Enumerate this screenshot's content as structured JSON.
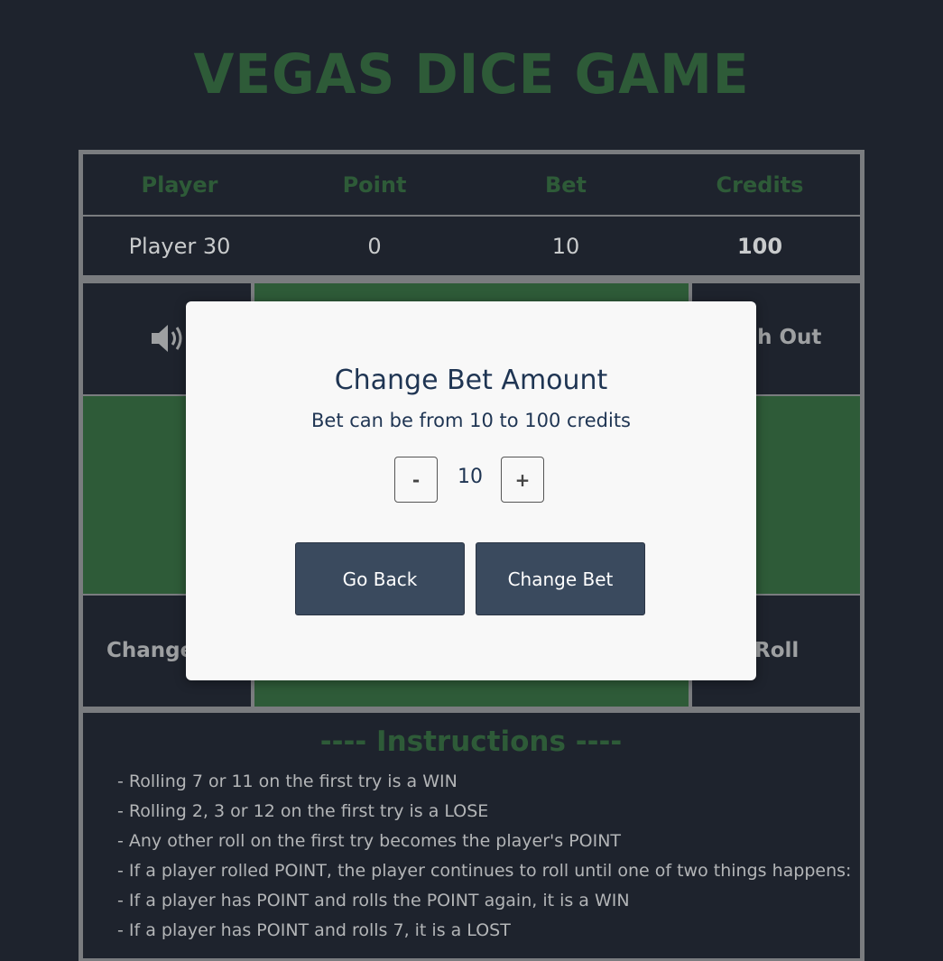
{
  "title": "Vegas Dice Game",
  "table": {
    "headers": [
      "Player",
      "Point",
      "Bet",
      "Credits"
    ],
    "values": [
      "Player 30",
      "0",
      "10",
      "100"
    ]
  },
  "controls": {
    "sound_icon": "speaker-icon",
    "cash_out_label": "Cash Out",
    "change_bet_label": "Change Bet",
    "roll_label": "Roll"
  },
  "instructions": {
    "title": "---- Instructions ----",
    "lines": [
      "- Rolling 7 or 11 on the first try is a WIN",
      "- Rolling 2, 3 or 12 on the first try is a LOSE",
      "- Any other roll on the first try becomes the player's POINT",
      "- If a player rolled POINT, the player continues to roll until one of two things happens:",
      "- If a player has POINT and rolls the POINT again, it is a WIN",
      "- If a player has POINT and rolls 7, it is a LOST"
    ]
  },
  "modal": {
    "title": "Change Bet Amount",
    "subtitle": "Bet can be from 10 to 100 credits",
    "decrement": "-",
    "increment": "+",
    "bet_value": "10",
    "go_back": "Go Back",
    "change_bet": "Change Bet"
  },
  "colors": {
    "background": "#1e232d",
    "accent_green": "#2e5b38",
    "button": "#3a4a5e"
  }
}
